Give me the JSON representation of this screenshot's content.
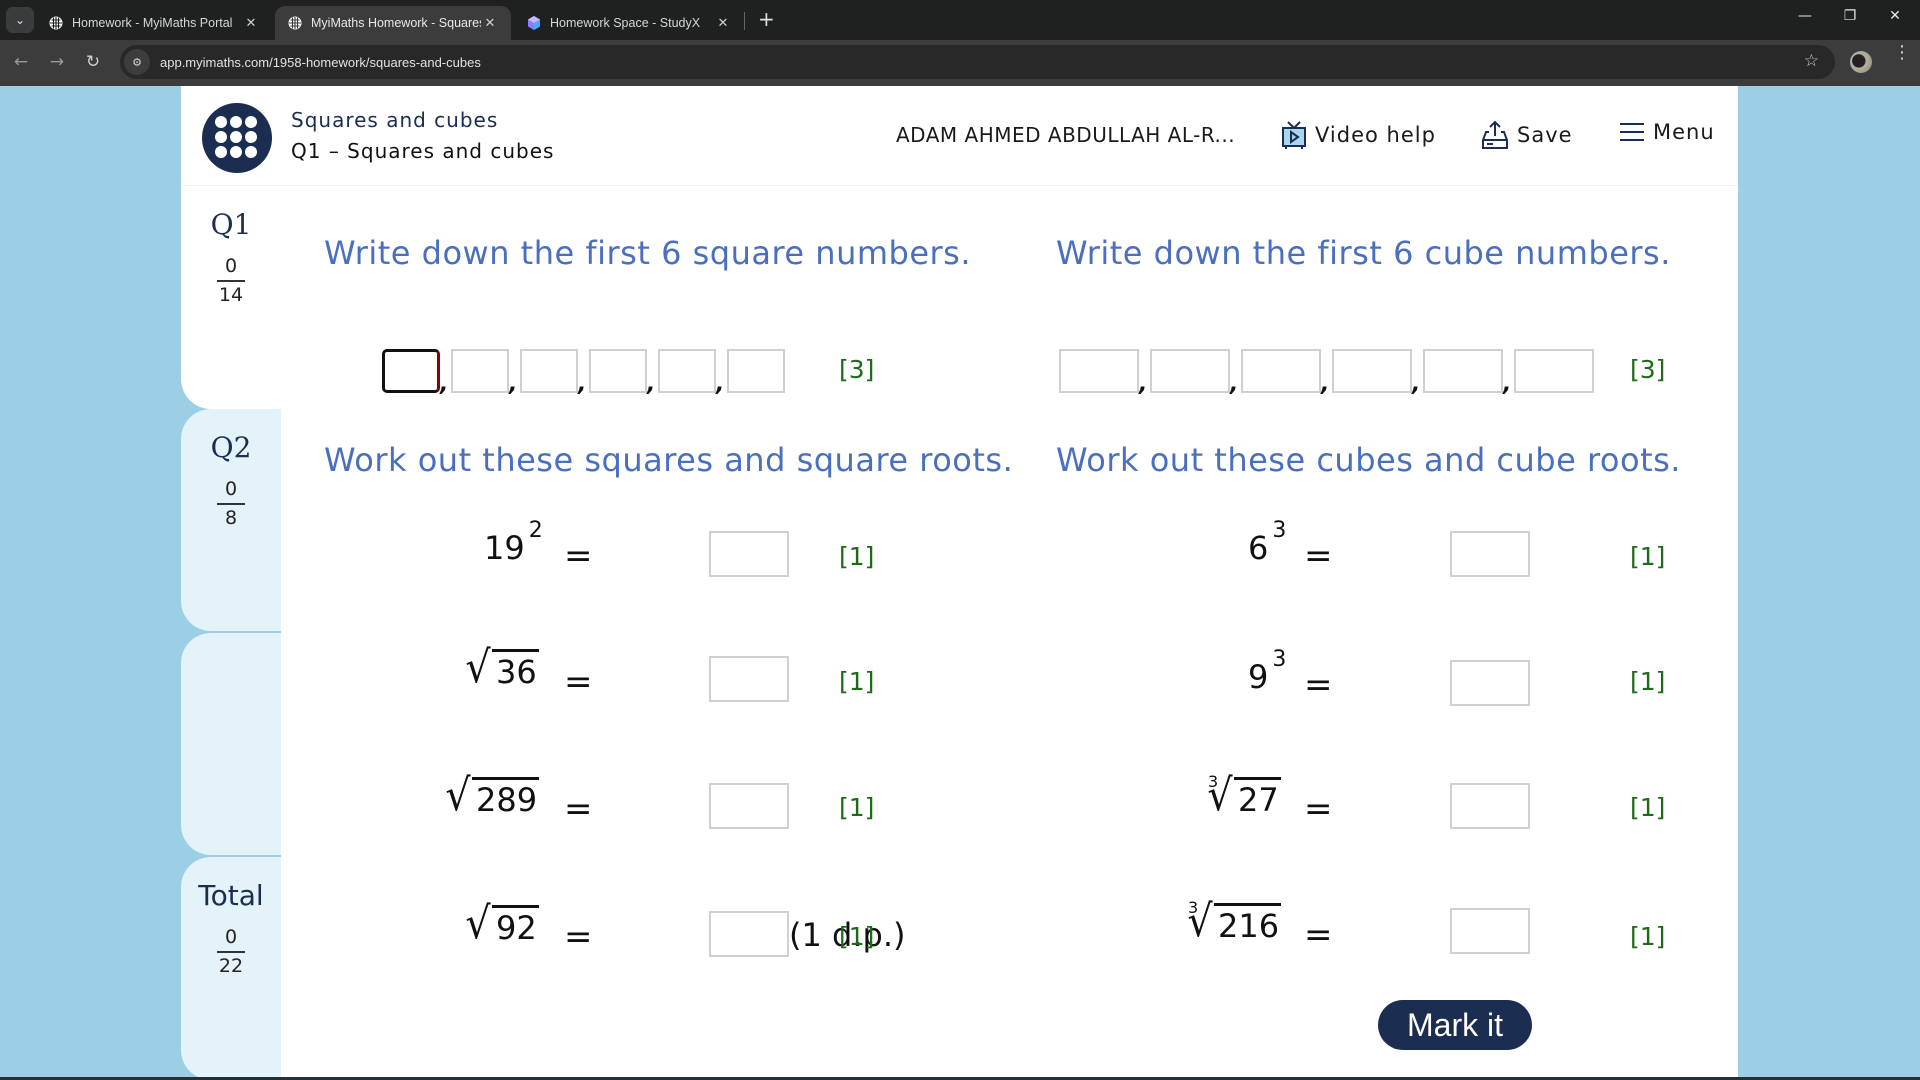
{
  "browser": {
    "tabs": [
      {
        "title": "Homework - MyiMaths Portal",
        "icon": "globe-icon",
        "active": false
      },
      {
        "title": "MyiMaths Homework - Squares and cubes",
        "icon": "globe-icon",
        "active": true
      },
      {
        "title": "Homework Space - StudyX",
        "icon": "studyx-gem-icon",
        "active": false
      }
    ],
    "url": "app.myimaths.com/1958-homework/squares-and-cubes",
    "new_tab_symbol": "+",
    "close_symbol": "✕"
  },
  "header": {
    "breadcrumb": "Squares and cubes",
    "question_title": "Q1 – Squares and cubes",
    "user_name": "ADAM AHMED ABDULLAH AL-R...",
    "video_help_label": "Video help",
    "save_label": "Save",
    "menu_label": "Menu"
  },
  "sidebar": {
    "questions": [
      {
        "label": "Q1",
        "score": "0",
        "max": "14"
      },
      {
        "label": "Q2",
        "score": "0",
        "max": "8"
      }
    ],
    "total": {
      "label": "Total",
      "score": "0",
      "max": "22"
    }
  },
  "main": {
    "q1a": {
      "heading": "Write down the first 6 square numbers.",
      "marks": "[3]",
      "inputs": [
        "",
        "",
        "",
        "",
        "",
        ""
      ]
    },
    "q1b": {
      "heading": "Write down the first 6 cube numbers.",
      "marks": "[3]",
      "inputs": [
        "",
        "",
        "",
        "",
        "",
        ""
      ]
    },
    "q2a": {
      "heading": "Work out these squares and square roots.",
      "items": [
        {
          "base": "19",
          "exp": "2",
          "type": "power",
          "marks": "[1]",
          "value": ""
        },
        {
          "radicand": "36",
          "type": "sqrt",
          "marks": "[1]",
          "value": ""
        },
        {
          "radicand": "289",
          "type": "sqrt",
          "marks": "[1]",
          "value": ""
        },
        {
          "radicand": "92",
          "type": "sqrt",
          "marks": "[1]",
          "value": "",
          "note": "(1 d.p.)"
        }
      ]
    },
    "q2b": {
      "heading": "Work out these cubes and cube roots.",
      "items": [
        {
          "base": "6",
          "exp": "3",
          "type": "power",
          "marks": "[1]",
          "value": ""
        },
        {
          "base": "9",
          "exp": "3",
          "type": "power",
          "marks": "[1]",
          "value": ""
        },
        {
          "radicand": "27",
          "index": "3",
          "type": "cbrt",
          "marks": "[1]",
          "value": ""
        },
        {
          "radicand": "216",
          "index": "3",
          "type": "cbrt",
          "marks": "[1]",
          "value": ""
        }
      ]
    },
    "equals": "=",
    "radical": "√",
    "mark_button": "Mark it"
  },
  "colors": {
    "brand_navy": "#1b2d50",
    "heading_blue": "#4a6fbf",
    "marks_green": "#1d6b17",
    "page_bg": "#9ccfe6"
  }
}
